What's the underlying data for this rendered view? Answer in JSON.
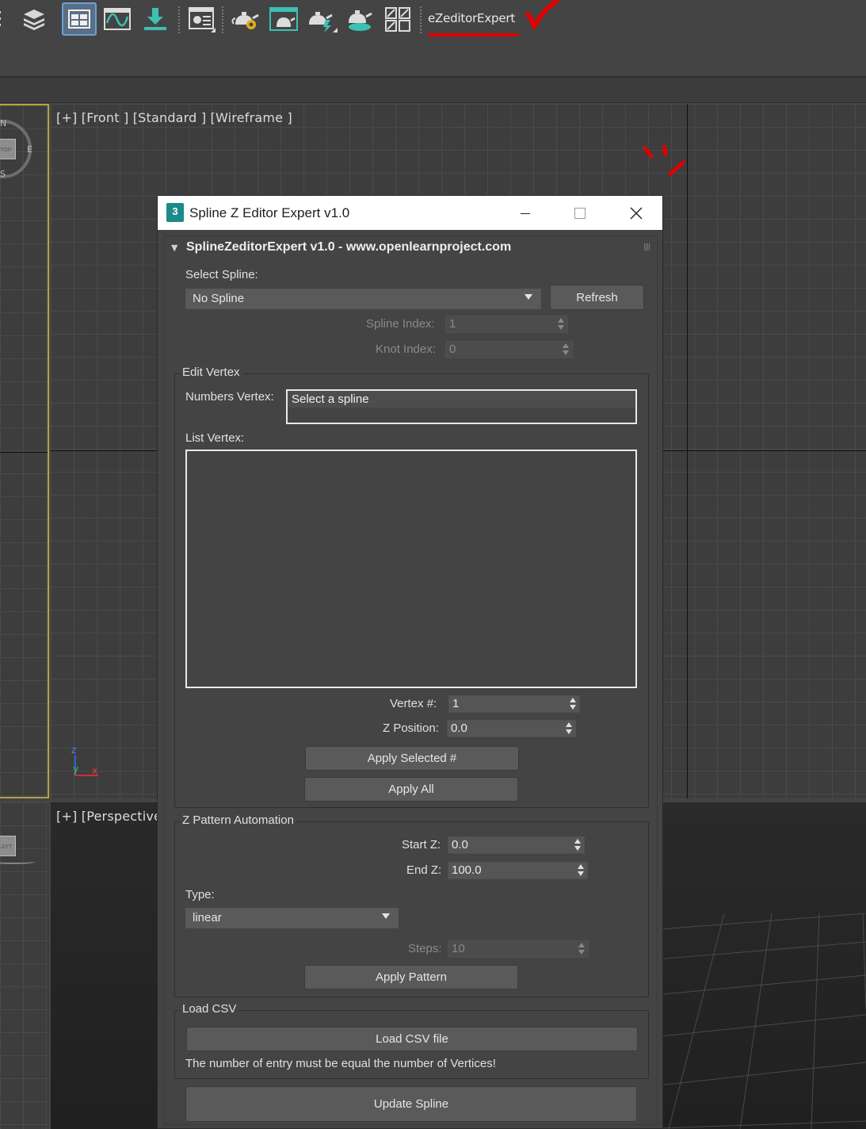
{
  "toolbar": {
    "icons": [
      "menu-partial-icon",
      "layer-stack-icon",
      "scene-explorer-icon",
      "curve-editor-icon",
      "import-icon",
      "render-setup-icon",
      "teapot-settings-icon",
      "teapot-frame-icon",
      "teapot-lightning-icon",
      "teapot-cloud-icon",
      "grid-shortcut-icon"
    ],
    "active_icon": "scene-explorer-icon",
    "custom_label": "eZeditorExpert",
    "annotation_color": "#e00000"
  },
  "viewports": {
    "front_label": "[+] [Front ] [Standard ] [Wireframe ]",
    "perspective_label": "[+] [Perspective",
    "viewcube_top": "TOP",
    "viewcube_left": "LEFT",
    "compass_n": "N",
    "compass_e": "E",
    "compass_s": "S",
    "axis_z": "z",
    "axis_y": "y",
    "axis_x": "x",
    "active_border_color": "#b6a244"
  },
  "dialog": {
    "title": "Spline Z Editor Expert v1.0",
    "app_icon_text": "3",
    "rollout_title": "SplineZeditorExpert v1.0 - www.openlearnproject.com",
    "select_spline_label": "Select Spline:",
    "spline_combo_value": "No Spline",
    "refresh_label": "Refresh",
    "spline_index_label": "Spline Index:",
    "spline_index_value": "1",
    "knot_index_label": "Knot Index:",
    "knot_index_value": "0",
    "edit_vertex": {
      "group_title": "Edit Vertex",
      "numbers_vertex_label": "Numbers Vertex:",
      "numbers_vertex_value": "Select a spline",
      "list_vertex_label": "List Vertex:",
      "vertex_num_label": "Vertex #:",
      "vertex_num_value": "1",
      "z_position_label": "Z Position:",
      "z_position_value": "0.0",
      "apply_selected_label": "Apply Selected #",
      "apply_all_label": "Apply All"
    },
    "z_pattern": {
      "group_title": "Z Pattern Automation",
      "start_z_label": "Start Z:",
      "start_z_value": "0.0",
      "end_z_label": "End Z:",
      "end_z_value": "100.0",
      "type_label": "Type:",
      "type_value": "linear",
      "steps_label": "Steps:",
      "steps_value": "10",
      "apply_pattern_label": "Apply Pattern"
    },
    "load_csv": {
      "group_title": "Load CSV",
      "load_button_label": "Load CSV file",
      "note": "The number of entry must be equal the number of Vertices!"
    },
    "update_spline_label": "Update Spline"
  }
}
